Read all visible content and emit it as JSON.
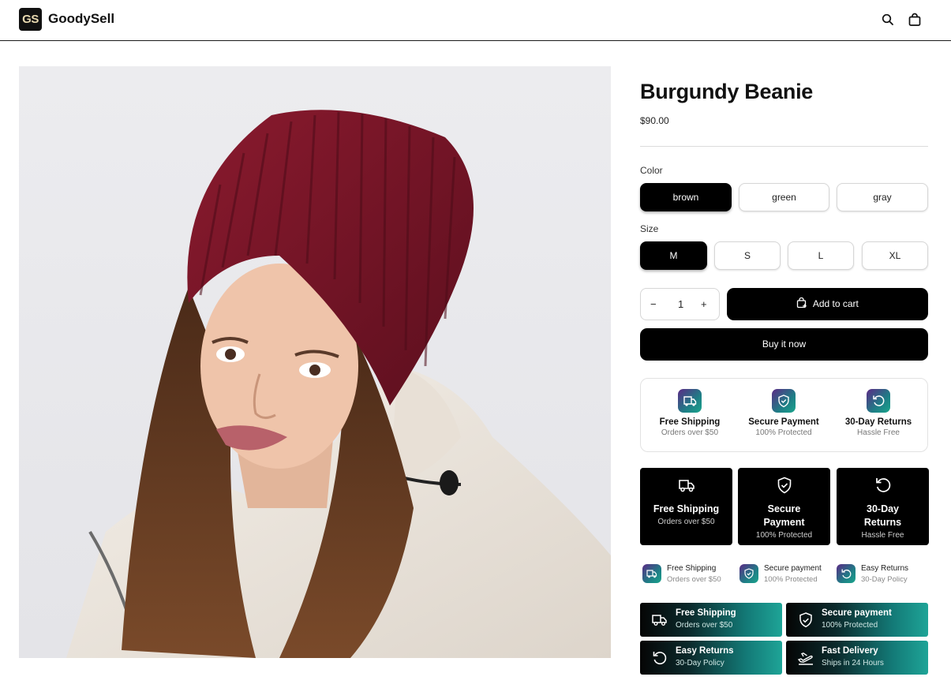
{
  "header": {
    "logo_text": "GS",
    "brand": "GoodySell",
    "icons": [
      "search-icon",
      "shopping-bag-icon"
    ]
  },
  "product": {
    "title": "Burgundy Beanie",
    "price": "$90.00",
    "image_alt": "Woman wearing burgundy knit beanie and cream puffer jacket"
  },
  "options": {
    "color_label": "Color",
    "colors": [
      "brown",
      "green",
      "gray"
    ],
    "selected_color": "brown",
    "size_label": "Size",
    "sizes": [
      "M",
      "S",
      "L",
      "XL"
    ],
    "selected_size": "M"
  },
  "purchase": {
    "qty_minus": "−",
    "qty_value": "1",
    "qty_plus": "+",
    "add_to_cart": "Add to cart",
    "buy_now": "Buy it now"
  },
  "trust_card": [
    {
      "title": "Free Shipping",
      "sub": "Orders over $50",
      "icon": "truck-icon"
    },
    {
      "title": "Secure Payment",
      "sub": "100% Protected",
      "icon": "shield-check-icon"
    },
    {
      "title": "30-Day Returns",
      "sub": "Hassle Free",
      "icon": "return-icon"
    }
  ],
  "tiles": [
    {
      "title_1": "Free Shipping",
      "title_2": "",
      "sub": "Orders over $50",
      "icon": "truck-icon"
    },
    {
      "title_1": "Secure",
      "title_2": "Payment",
      "sub": "100% Protected",
      "icon": "shield-check-icon"
    },
    {
      "title_1": "30-Day",
      "title_2": "Returns",
      "sub": "Hassle Free",
      "icon": "return-icon"
    }
  ],
  "mini_row": [
    {
      "title": "Free Shipping",
      "sub": "Orders over $50",
      "icon": "truck-icon"
    },
    {
      "title": "Secure payment",
      "sub": "100% Protected",
      "icon": "shield-check-icon"
    },
    {
      "title": "Easy Returns",
      "sub": "30-Day Policy",
      "icon": "return-icon"
    }
  ],
  "gradient_bars": [
    {
      "title": "Free Shipping",
      "sub": "Orders over $50",
      "icon": "truck-icon"
    },
    {
      "title": "Secure payment",
      "sub": "100% Protected",
      "icon": "shield-check-icon"
    },
    {
      "title": "Easy Returns",
      "sub": "30-Day Policy",
      "icon": "return-icon"
    },
    {
      "title": "Fast Delivery",
      "sub": "Ships in 24 Hours",
      "icon": "airplane-icon"
    }
  ],
  "colors": {
    "accent": "#000000",
    "beanie": "#7a1526",
    "gradient_start": "#050505",
    "gradient_end": "#1ea497"
  }
}
